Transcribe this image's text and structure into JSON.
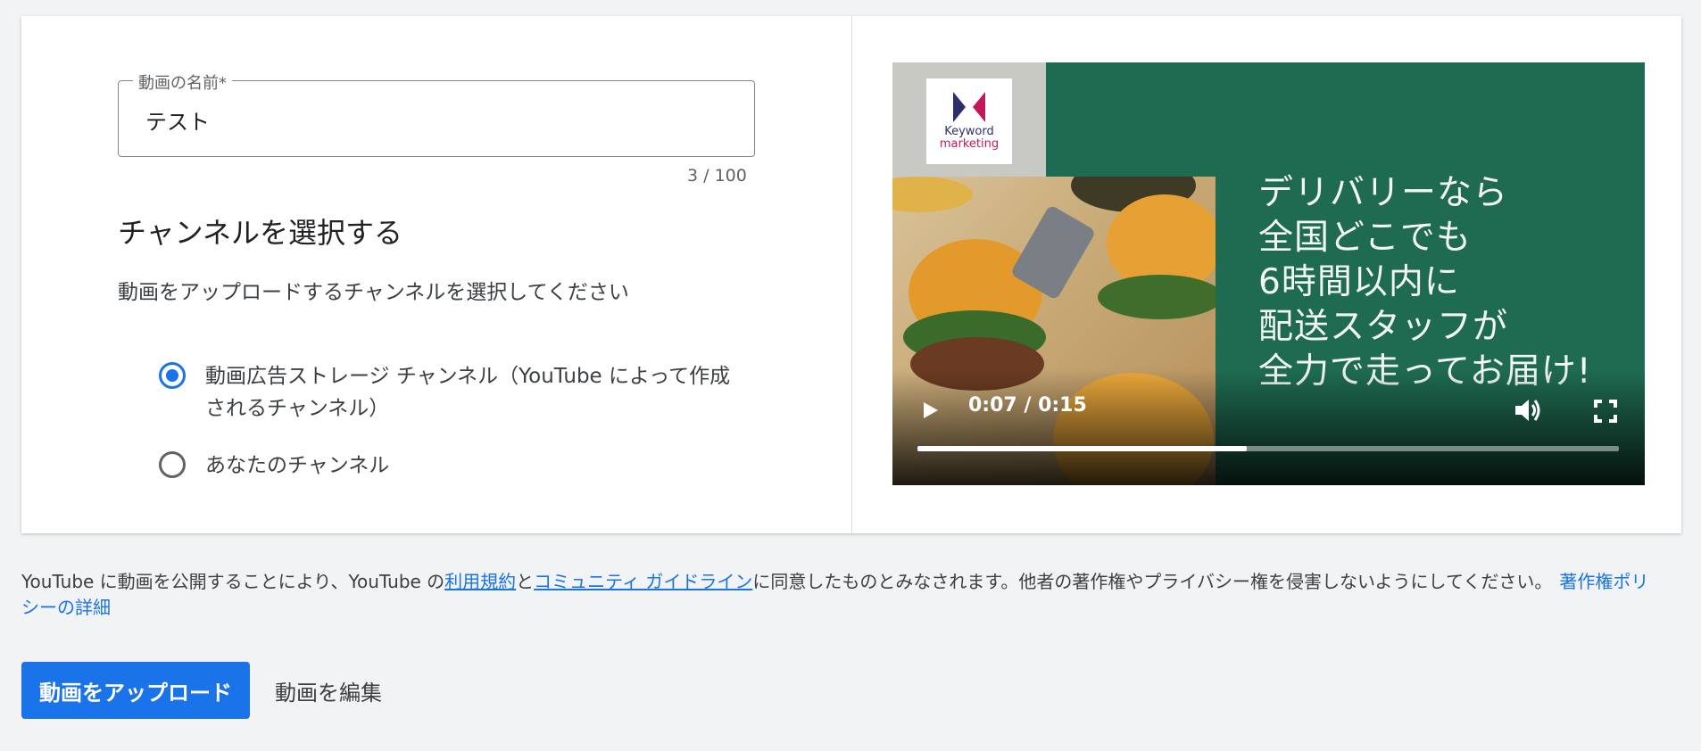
{
  "form": {
    "title_label": "動画の名前*",
    "title_value": "テスト",
    "char_count": "3 / 100",
    "channel_heading": "チャンネルを選択する",
    "channel_description": "動画をアップロードするチャンネルを選択してください",
    "channel_options": [
      {
        "label": "動画広告ストレージ チャンネル（YouTube によって作成されるチャンネル）",
        "selected": true
      },
      {
        "label": "あなたのチャンネル",
        "selected": false
      }
    ]
  },
  "video": {
    "brand_line1": "Keyword",
    "brand_line2": "marketing",
    "headline": [
      "デリバリーなら",
      "全国どこでも",
      "6時間以内に",
      "配送スタッフが",
      "全力で走ってお届け!"
    ],
    "time": "0:07 / 0:15",
    "progress_fraction": 0.47,
    "icons": [
      "play-icon",
      "volume-icon",
      "fullscreen-icon"
    ]
  },
  "terms": {
    "prefix": "YouTube に動画を公開することにより、YouTube の",
    "tos_link": "利用規約",
    "and": "と",
    "guidelines_link": "コミュニティ ガイドライン",
    "suffix": "に同意したものとみなされます。他者の著作権やプライバシー権を侵害しないようにしてください。",
    "policy_link": "著作権ポリシーの詳細"
  },
  "actions": {
    "upload_label": "動画をアップロード",
    "edit_label": "動画を編集"
  },
  "colors": {
    "accent": "#1a73e8",
    "video_background": "#1f6b52"
  }
}
